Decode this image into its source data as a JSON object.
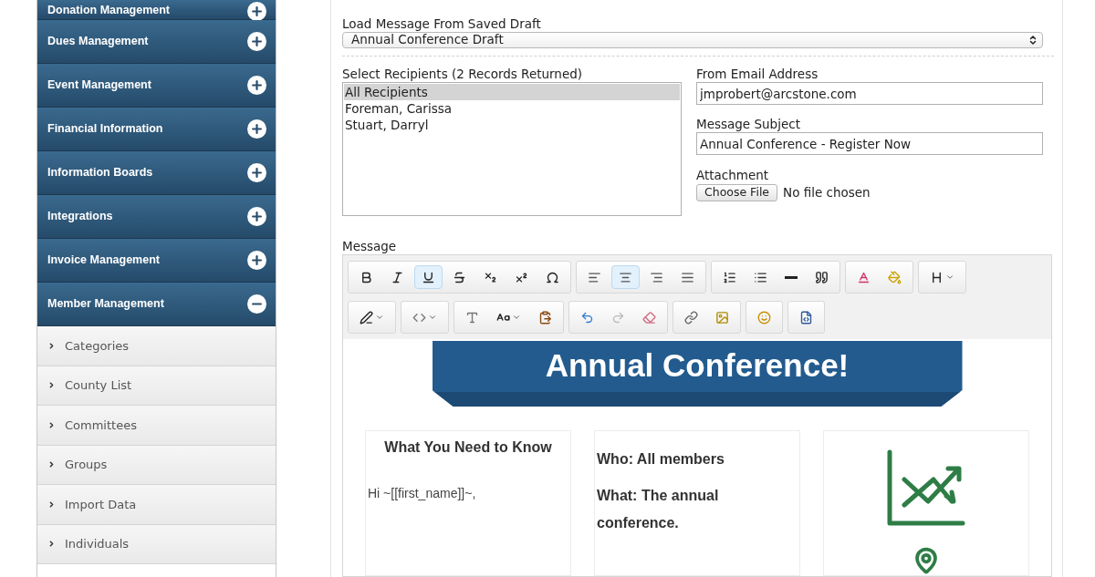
{
  "sidebar": {
    "sections": [
      {
        "label": "Donation Management",
        "expanded": false
      },
      {
        "label": "Dues Management",
        "expanded": false
      },
      {
        "label": "Event Management",
        "expanded": false
      },
      {
        "label": "Financial Information",
        "expanded": false
      },
      {
        "label": "Information Boards",
        "expanded": false
      },
      {
        "label": "Integrations",
        "expanded": false
      },
      {
        "label": "Invoice Management",
        "expanded": false
      },
      {
        "label": "Member Management",
        "expanded": true,
        "children": [
          {
            "label": "Categories"
          },
          {
            "label": "County List"
          },
          {
            "label": "Committees"
          },
          {
            "label": "Groups"
          },
          {
            "label": "Import Data"
          },
          {
            "label": "Individuals"
          }
        ]
      }
    ]
  },
  "form": {
    "draft": {
      "label": "Load Message From Saved Draft",
      "value": "Annual Conference Draft"
    },
    "recipients": {
      "label": "Select Recipients (2 Records Returned)",
      "options": [
        {
          "label": "All Recipients",
          "selected": true
        },
        {
          "label": "Foreman, Carissa",
          "selected": false
        },
        {
          "label": "Stuart, Darryl",
          "selected": false
        }
      ]
    },
    "from": {
      "label": "From Email Address",
      "value": "jmprobert@arcstone.com"
    },
    "subject": {
      "label": "Message Subject",
      "value": "Annual Conference - Register Now"
    },
    "attachment": {
      "label": "Attachment",
      "button": "Choose File",
      "status": "No file chosen"
    },
    "message": {
      "label": "Message"
    }
  },
  "toolbar": {
    "rows": [
      [
        [
          {
            "kind": "bold",
            "selected": false
          },
          {
            "kind": "italic",
            "selected": false
          },
          {
            "kind": "underline",
            "selected": true
          },
          {
            "kind": "strike",
            "selected": false
          },
          {
            "kind": "subscript",
            "selected": false
          },
          {
            "kind": "superscript",
            "selected": false
          },
          {
            "kind": "special",
            "selected": false
          }
        ],
        [
          {
            "kind": "align-left",
            "selected": false
          },
          {
            "kind": "align-center",
            "selected": true
          },
          {
            "kind": "align-right",
            "selected": false
          },
          {
            "kind": "justify",
            "selected": false
          }
        ],
        [
          {
            "kind": "ordered-list",
            "selected": false
          },
          {
            "kind": "bullet-list",
            "selected": false
          },
          {
            "kind": "rule",
            "selected": false
          },
          {
            "kind": "quote",
            "selected": false
          }
        ],
        [
          {
            "kind": "text-color",
            "selected": false
          },
          {
            "kind": "highlight",
            "selected": false
          }
        ],
        [
          {
            "kind": "heading",
            "selected": false
          }
        ]
      ],
      [
        [
          {
            "kind": "format",
            "selected": false
          }
        ],
        [
          {
            "kind": "code",
            "selected": false
          }
        ],
        [
          {
            "kind": "font",
            "selected": false
          },
          {
            "kind": "size",
            "selected": false
          },
          {
            "kind": "paste",
            "selected": false
          }
        ],
        [
          {
            "kind": "undo",
            "selected": false
          },
          {
            "kind": "redo",
            "selected": false
          },
          {
            "kind": "eraser",
            "selected": false
          }
        ],
        [
          {
            "kind": "link",
            "selected": false
          },
          {
            "kind": "image",
            "selected": false
          }
        ],
        [
          {
            "kind": "emoji",
            "selected": false
          }
        ],
        [
          {
            "kind": "source",
            "selected": false
          }
        ]
      ]
    ]
  },
  "editor": {
    "banner": "Annual Conference!",
    "cards": [
      {
        "heading": "What You Need to Know",
        "lines": [
          "Hi ~[[first_name]]~,"
        ]
      },
      {
        "lines": [
          "Who: All members",
          "What: The annual conference."
        ]
      },
      {
        "kind": "chart"
      }
    ]
  }
}
